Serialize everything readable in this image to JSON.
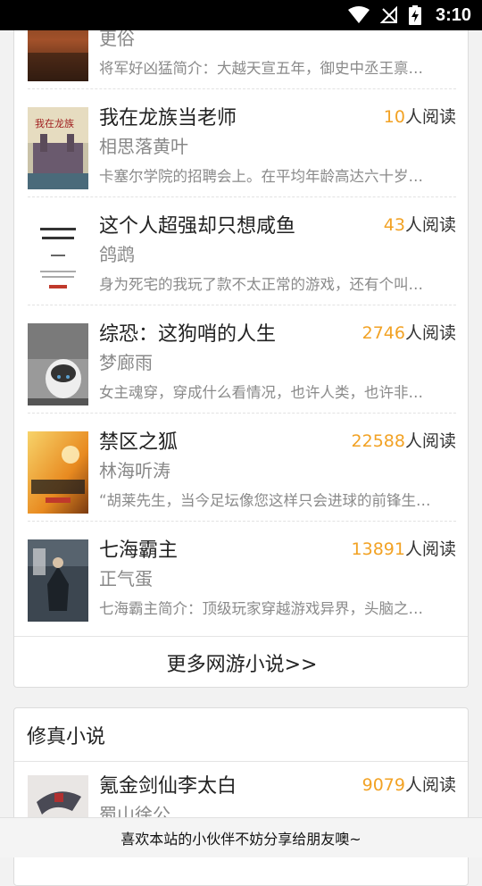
{
  "status_bar": {
    "time": "3:10"
  },
  "online_game_section": {
    "books": [
      {
        "title": "",
        "author": "更俗",
        "reads_num": "",
        "reads_suffix": "",
        "desc": "将军好凶猛简介：大越天宣五年，御史中丞王禀…"
      },
      {
        "title": "我在龙族当老师",
        "author": "相思落黄叶",
        "reads_num": "10",
        "reads_suffix": "人阅读",
        "desc": "卡塞尔学院的招聘会上。在平均年龄高达六十岁…"
      },
      {
        "title": "这个人超强却只想咸鱼",
        "author": "鸽鹉",
        "reads_num": "43",
        "reads_suffix": "人阅读",
        "desc": "身为死宅的我玩了款不太正常的游戏，还有个叫…"
      },
      {
        "title": "综恐：这狗哨的人生",
        "author": "梦廊雨",
        "reads_num": "2746",
        "reads_suffix": "人阅读",
        "desc": " 女主魂穿，穿成什么看情况，也许人类，也许非…"
      },
      {
        "title": "禁区之狐",
        "author": "林海听涛",
        "reads_num": "22588",
        "reads_suffix": "人阅读",
        "desc": "“胡莱先生，当今足坛像您这样只会进球的前锋生…"
      },
      {
        "title": "七海霸主",
        "author": "正气蛋",
        "reads_num": "13891",
        "reads_suffix": "人阅读",
        "desc": "七海霸主简介：顶级玩家穿越游戏异界，头脑之…"
      }
    ],
    "more_link": "更多网游小说>>"
  },
  "xianxia_section": {
    "title": "修真小说",
    "books": [
      {
        "title": "氪金剑仙李太白",
        "author": "蜀山徐公",
        "reads_num": "9079",
        "reads_suffix": "人阅读"
      }
    ]
  },
  "share_bar": {
    "text": "喜欢本站的小伙伴不妨分享给朋友噢~"
  },
  "colors": {
    "accent": "#f2a224",
    "text": "#222222",
    "muted": "#888888"
  }
}
